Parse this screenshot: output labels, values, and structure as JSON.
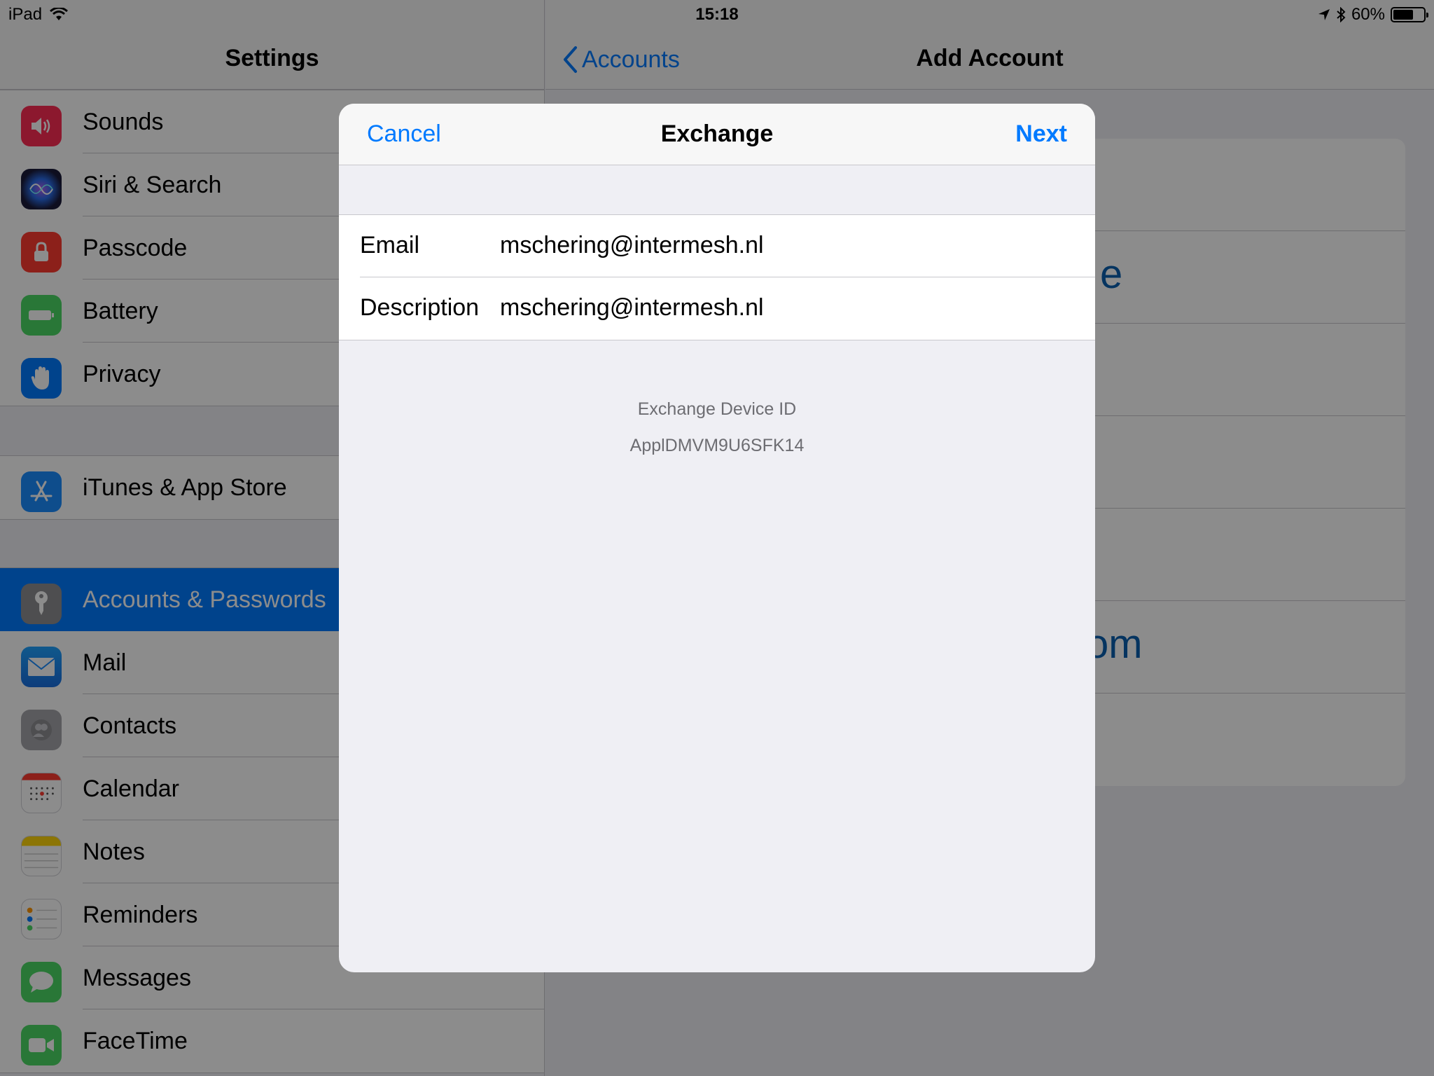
{
  "status_bar": {
    "device": "iPad",
    "time": "15:18",
    "battery": "60%"
  },
  "master": {
    "title": "Settings",
    "groups": [
      [
        {
          "label": "Sounds",
          "icon": "speaker-icon",
          "color": "#ff2d55"
        },
        {
          "label": "Siri & Search",
          "icon": "siri-icon",
          "color": "#1b1b3a"
        },
        {
          "label": "Passcode",
          "icon": "lock-icon",
          "color": "#ff3b30"
        },
        {
          "label": "Battery",
          "icon": "battery-icon",
          "color": "#4cd964"
        },
        {
          "label": "Privacy",
          "icon": "hand-icon",
          "color": "#007aff"
        }
      ],
      [
        {
          "label": "iTunes & App Store",
          "icon": "app-store-icon",
          "color": "#1a8cff"
        }
      ],
      [
        {
          "label": "Accounts & Passwords",
          "icon": "key-icon",
          "color": "#8e8e93",
          "selected": true
        },
        {
          "label": "Mail",
          "icon": "envelope-icon",
          "color": "#1a8cff"
        },
        {
          "label": "Contacts",
          "icon": "contacts-icon",
          "color": "#a5a5aa"
        },
        {
          "label": "Calendar",
          "icon": "calendar-icon",
          "color": "#ffffff"
        },
        {
          "label": "Notes",
          "icon": "notes-icon",
          "color": "#ffd60a"
        },
        {
          "label": "Reminders",
          "icon": "reminders-icon",
          "color": "#ffffff"
        },
        {
          "label": "Messages",
          "icon": "message-bubble-icon",
          "color": "#4cd964"
        },
        {
          "label": "FaceTime",
          "icon": "video-camera-icon",
          "color": "#4cd964"
        }
      ]
    ]
  },
  "detail": {
    "back_label": "Accounts",
    "title": "Add Account",
    "provider_fragments": [
      "e",
      "om"
    ]
  },
  "modal": {
    "cancel_label": "Cancel",
    "title": "Exchange",
    "next_label": "Next",
    "fields": [
      {
        "label": "Email",
        "value": "mschering@intermesh.nl"
      },
      {
        "label": "Description",
        "value": "mschering@intermesh.nl"
      }
    ],
    "footer_label": "Exchange Device ID",
    "device_id": "ApplDMVM9U6SFK14"
  }
}
